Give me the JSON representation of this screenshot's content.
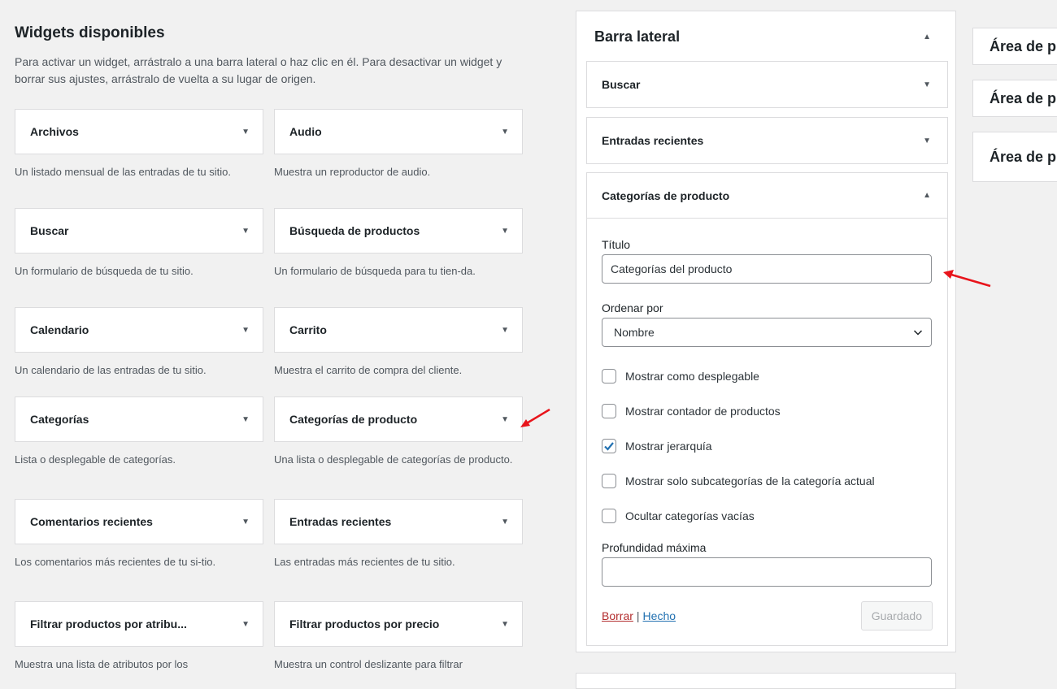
{
  "available": {
    "title": "Widgets disponibles",
    "description": "Para activar un widget, arrástralo a una barra lateral o haz clic en él. Para desactivar un widget y borrar sus ajustes, arrástralo de vuelta a su lugar de origen.",
    "widgets": [
      {
        "title": "Archivos",
        "desc": "Un listado mensual de las entradas de tu sitio."
      },
      {
        "title": "Audio",
        "desc": "Muestra un reproductor de audio."
      },
      {
        "title": "Buscar",
        "desc": "Un formulario de búsqueda de tu sitio."
      },
      {
        "title": "Búsqueda de productos",
        "desc": "Un formulario de búsqueda para tu tien-da."
      },
      {
        "title": "Calendario",
        "desc": "Un calendario de las entradas de tu sitio."
      },
      {
        "title": "Carrito",
        "desc": "Muestra el carrito de compra del cliente."
      },
      {
        "title": "Categorías",
        "desc": "Lista o desplegable de categorías."
      },
      {
        "title": "Categorías de producto",
        "desc": "Una lista o desplegable de categorías de producto."
      },
      {
        "title": "Comentarios recientes",
        "desc": "Los comentarios más recientes de tu si-tio."
      },
      {
        "title": "Entradas recientes",
        "desc": "Las entradas más recientes de tu sitio."
      },
      {
        "title": "Filtrar productos por atribu...",
        "desc": "Muestra una lista de atributos por los"
      },
      {
        "title": "Filtrar productos por precio",
        "desc": "Muestra un control deslizante para filtrar"
      }
    ]
  },
  "sidebar": {
    "title": "Barra lateral",
    "widgets": [
      {
        "title": "Buscar"
      },
      {
        "title": "Entradas recientes"
      },
      {
        "title": "Categorías de producto"
      }
    ],
    "form": {
      "title_label": "Título",
      "title_value": "Categorías del producto",
      "order_label": "Ordenar por",
      "order_value": "Nombre",
      "options": [
        {
          "label": "Mostrar como desplegable",
          "checked": false
        },
        {
          "label": "Mostrar contador de productos",
          "checked": false
        },
        {
          "label": "Mostrar jerarquía",
          "checked": true
        },
        {
          "label": "Mostrar solo subcategorías de la categoría actual",
          "checked": false
        },
        {
          "label": "Ocultar categorías vacías",
          "checked": false
        }
      ],
      "depth_label": "Profundidad máxima",
      "depth_value": "",
      "delete_link": "Borrar",
      "separator": "|",
      "done_link": "Hecho",
      "save_button": "Guardado"
    }
  },
  "other_areas": [
    {
      "title": "Área de p"
    },
    {
      "title": "Área de p"
    },
    {
      "title": "Área de p"
    }
  ],
  "colors": {
    "annotation_arrow": "#e8141b",
    "link": "#2271b1",
    "delete": "#b32d2e",
    "check": "#2271b1"
  }
}
